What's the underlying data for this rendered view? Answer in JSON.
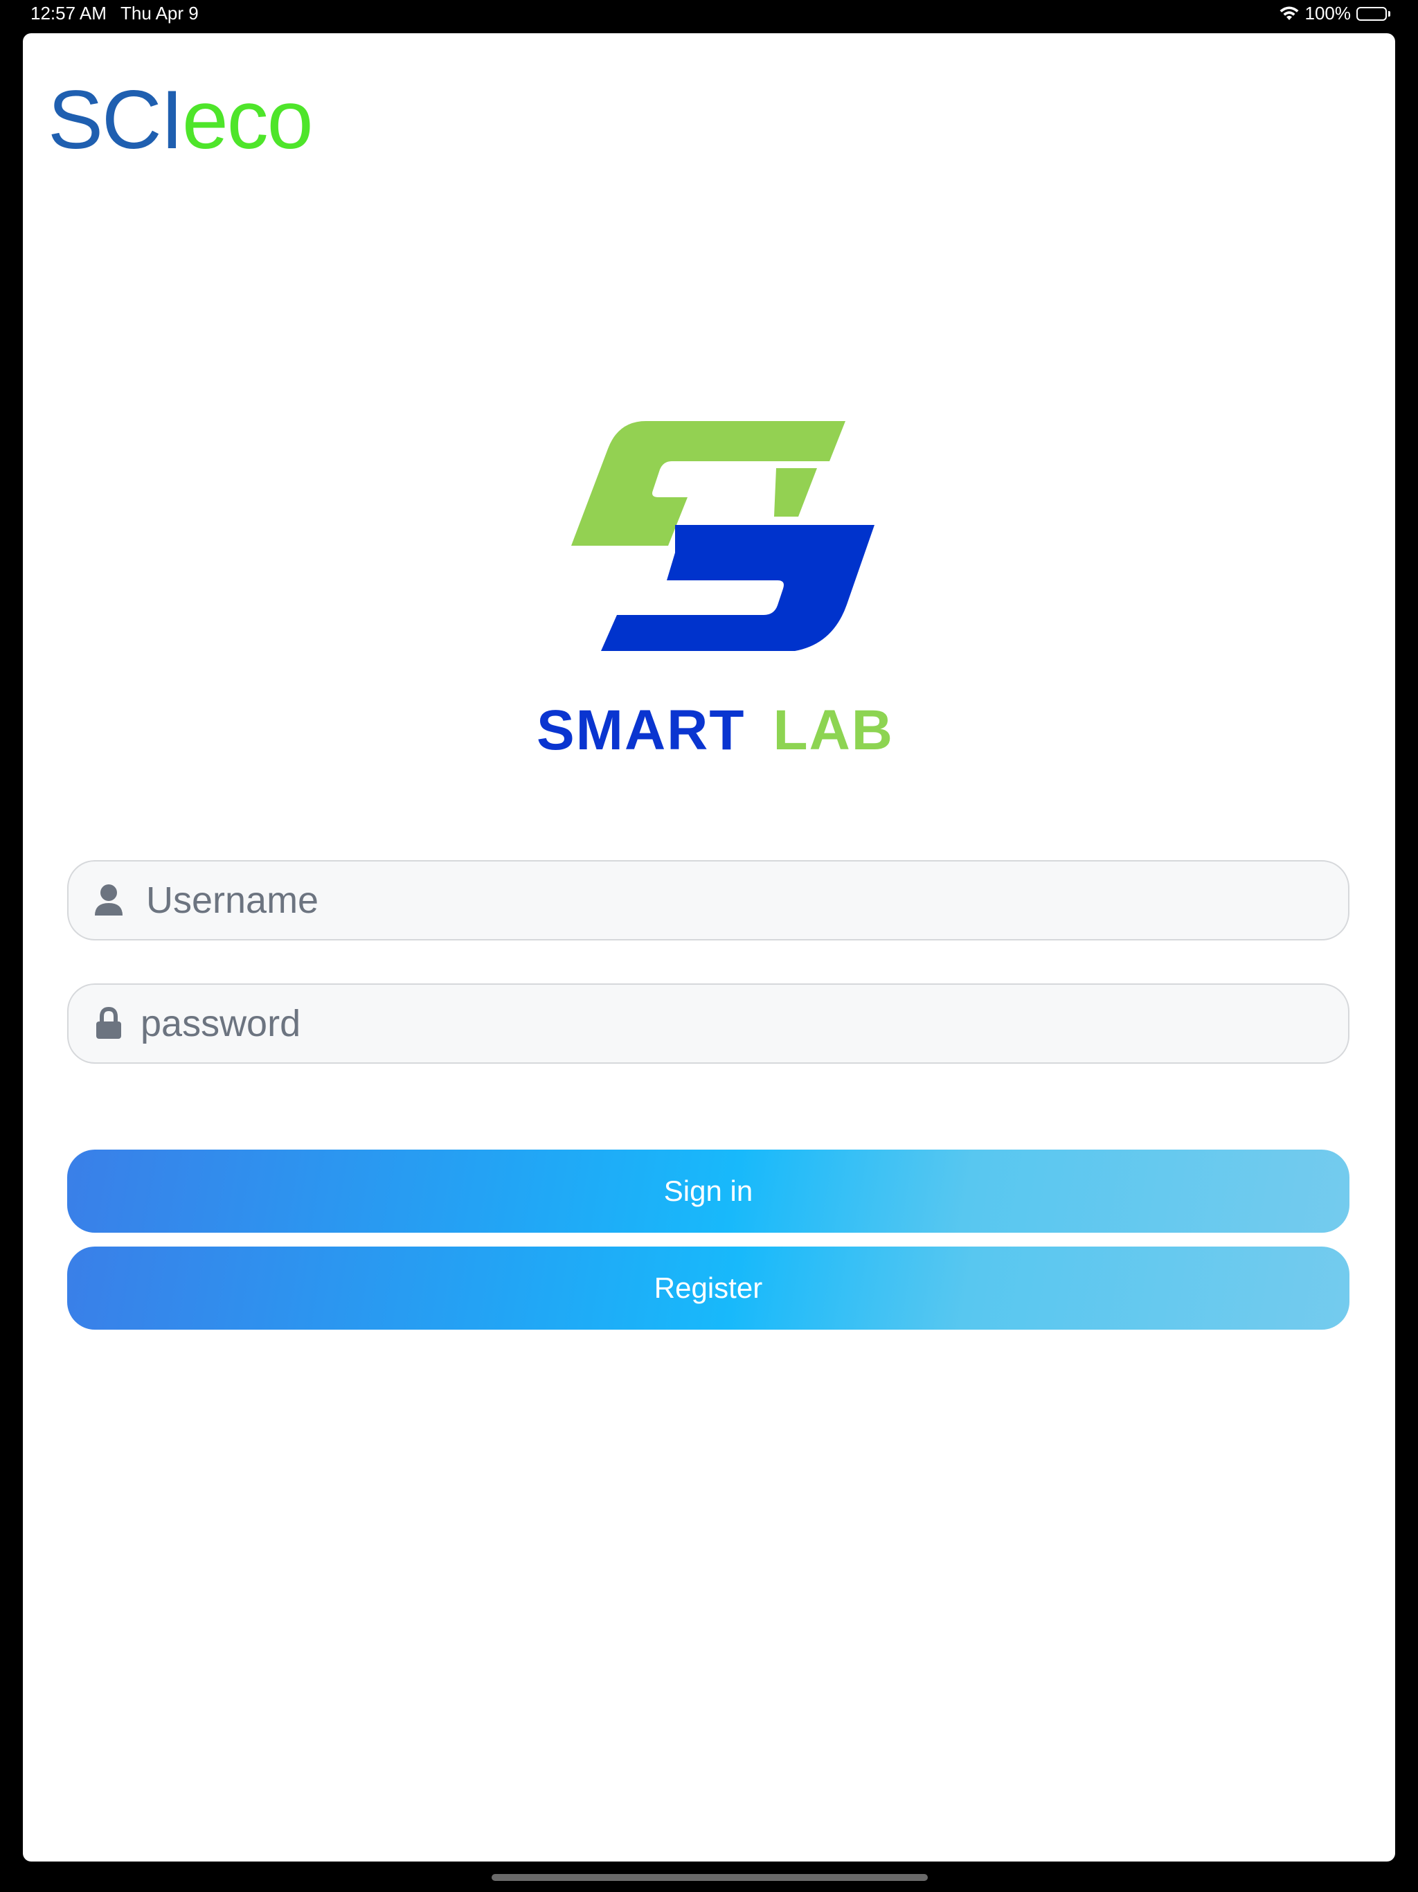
{
  "status_bar": {
    "time": "12:57 AM",
    "date": "Thu Apr 9",
    "battery": "100%",
    "battery_level": 1.0,
    "icons": [
      "wifi-icon",
      "battery-icon"
    ]
  },
  "brand": {
    "part1": "SCI",
    "part2": "eco",
    "color1": "#1f5fb0",
    "color2": "#4ee52a"
  },
  "app_logo": {
    "word1": "SMART",
    "word2": "LAB",
    "green": "#8dd452",
    "blue": "#0a35d0"
  },
  "form": {
    "username": {
      "placeholder": "Username",
      "value": "",
      "icon": "user-icon"
    },
    "password": {
      "placeholder": "password",
      "value": "",
      "icon": "lock-icon"
    }
  },
  "buttons": {
    "signin_label": "Sign in",
    "register_label": "Register"
  }
}
